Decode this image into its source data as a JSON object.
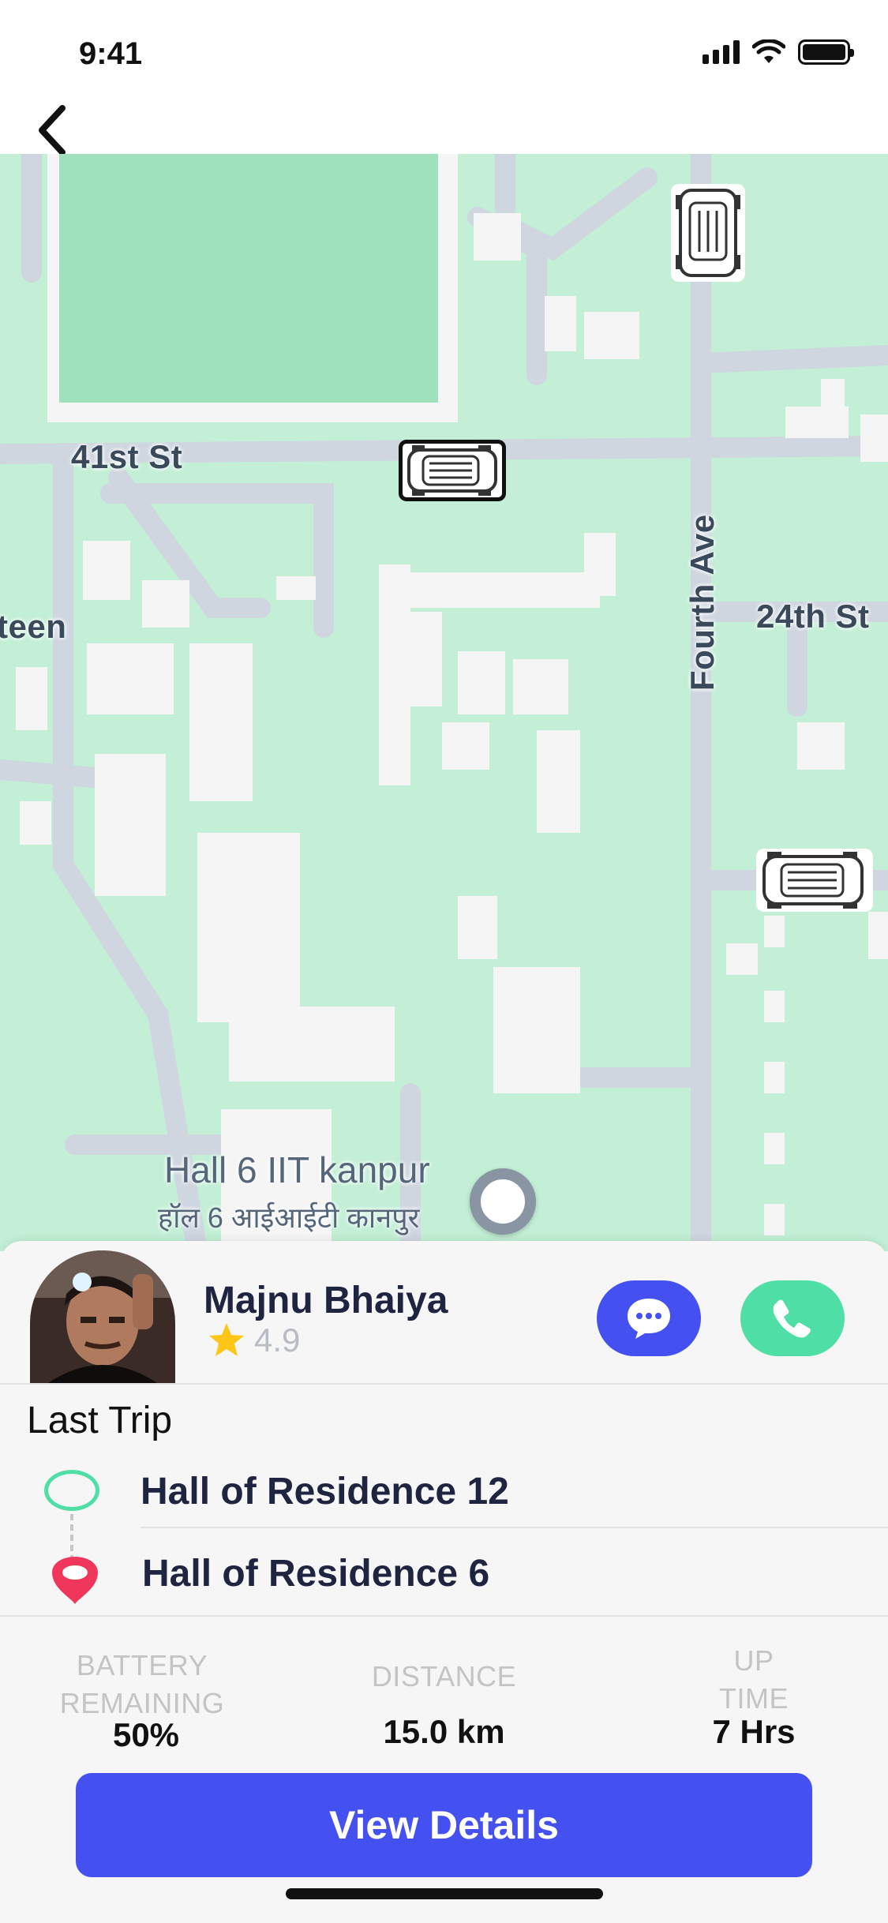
{
  "status_bar": {
    "time": "9:41"
  },
  "map": {
    "streets": {
      "st_41": "41st St",
      "fourth_ave": "Fourth Ave",
      "st_24": "24th St",
      "partial": "teen"
    },
    "place": {
      "name": "Hall 6 IIT kanpur",
      "name_hi": "हॉल 6 आईआईटी कानपुर"
    }
  },
  "driver": {
    "name": "Majnu Bhaiya",
    "rating": "4.9"
  },
  "last_trip": {
    "title": "Last Trip",
    "from": "Hall of Residence 12",
    "to": "Hall of Residence 6"
  },
  "stats": [
    {
      "label_line1": "BATTERY",
      "label_line2": "REMAINING",
      "value": "50%"
    },
    {
      "label_line1": "DISTANCE",
      "label_line2": "",
      "value": "15.0 km"
    },
    {
      "label_line1": "UP",
      "label_line2": "TIME",
      "value": "7 Hrs"
    }
  ],
  "actions": {
    "view_details": "View Details"
  },
  "colors": {
    "primary": "#4451f0",
    "call": "#4fdea6",
    "map_bg": "#c2efd5",
    "destination": "#f0365a"
  },
  "icons": [
    "back-icon",
    "chat-icon",
    "phone-icon",
    "star-icon",
    "origin-icon",
    "destination-pin-icon",
    "cart-icon"
  ]
}
